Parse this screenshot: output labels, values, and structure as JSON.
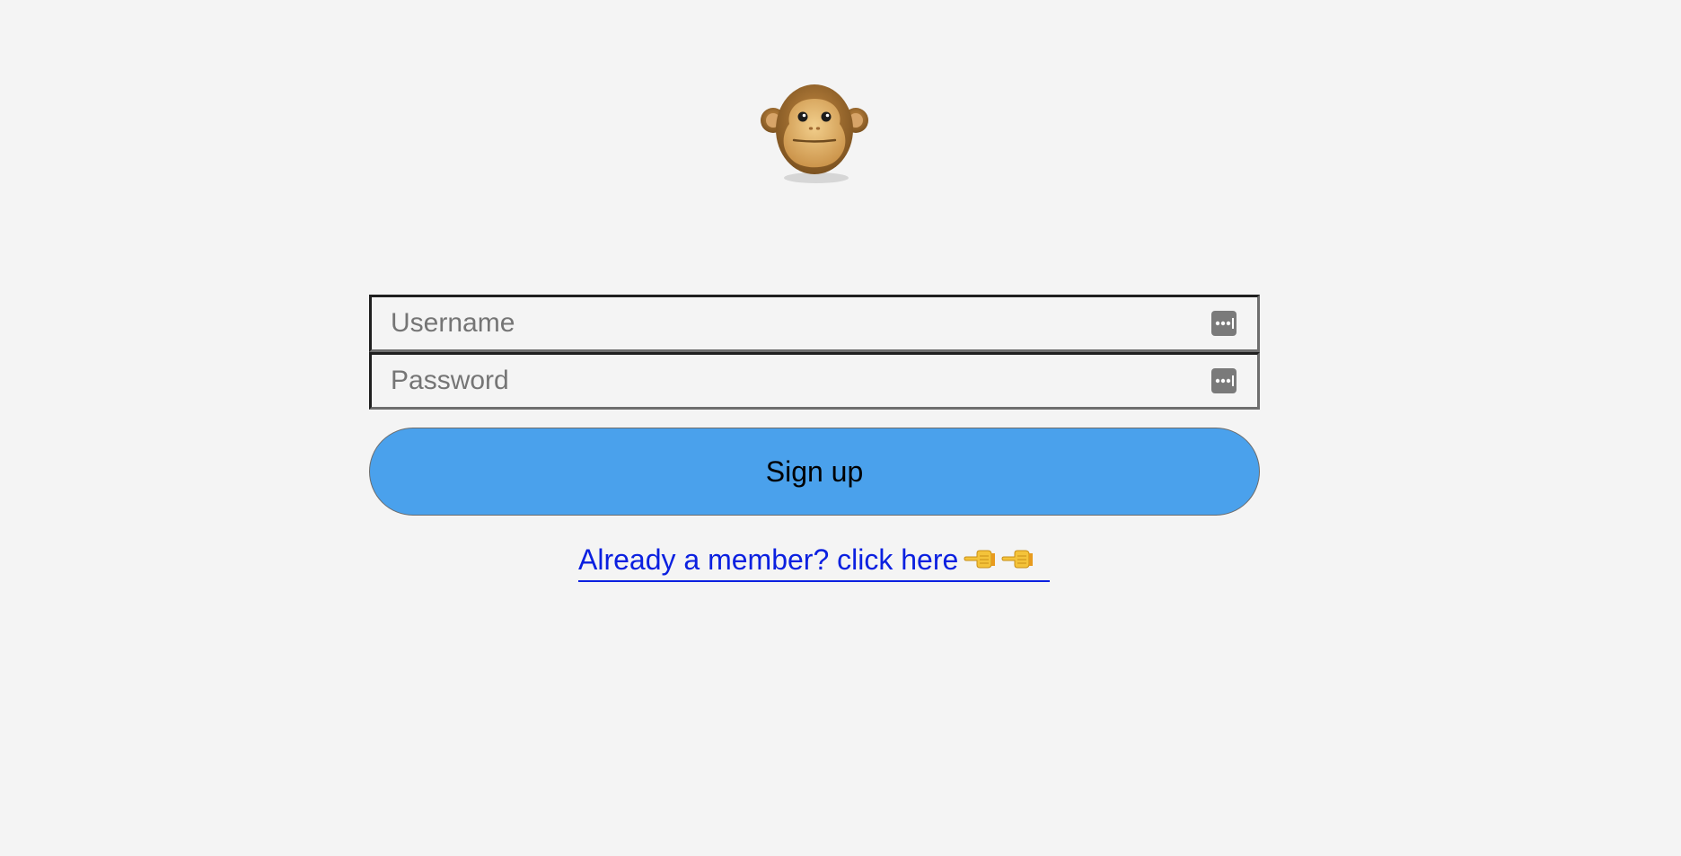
{
  "logo": {
    "icon": "monkey-face-icon",
    "colors": {
      "fur": "#9a6b2e",
      "face": "#e2b46c"
    }
  },
  "form": {
    "username": {
      "placeholder": "Username",
      "value": "",
      "icon": "password-manager-key-icon"
    },
    "password": {
      "placeholder": "Password",
      "value": "",
      "icon": "password-manager-key-icon"
    },
    "signup_label": "Sign up",
    "signup_color": "#4aa1ec"
  },
  "member_link": {
    "text": "Already a member? click here",
    "icons": [
      "pointing-left-hand-icon",
      "pointing-left-hand-icon"
    ],
    "color": "#0b20e0"
  }
}
